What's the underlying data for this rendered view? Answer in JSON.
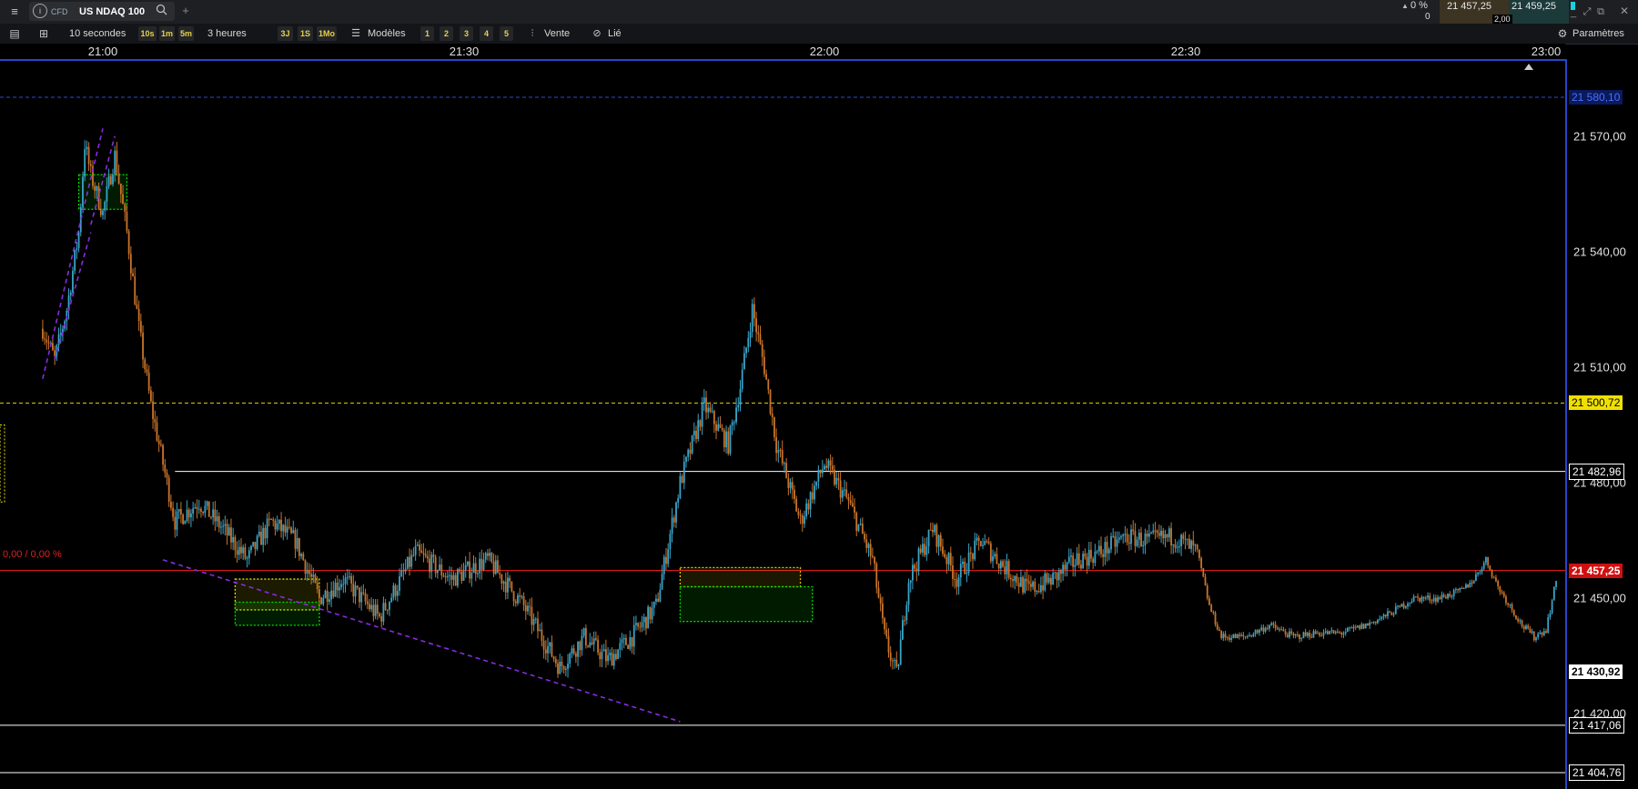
{
  "header": {
    "menu_icon": "hamburger-icon",
    "instrument_icon": "info-circle-icon",
    "instrument_type": "CFD",
    "instrument_name": "US NDAQ 100",
    "search_icon": "search-icon",
    "add_tab_icon": "plus-icon",
    "change_pct": "0 %",
    "change_qty": "0",
    "sell_price": "21 457,25",
    "buy_price": "21 459,25",
    "spread": "2,00"
  },
  "toolbar": {
    "interval": "10 secondes",
    "interval_presets": [
      "10s",
      "1m",
      "5m"
    ],
    "period": "3 heures",
    "period_presets": [
      "3J",
      "1S",
      "1Mo"
    ],
    "templates_label": "Modèles",
    "numbered_presets": [
      "1",
      "2",
      "3",
      "4",
      "5"
    ],
    "sell_label": "Vente",
    "linked_label": "Lié",
    "settings_label": "Paramètres"
  },
  "chart_data": {
    "type": "candlestick",
    "instrument": "US NDAQ 100",
    "x_ticks": [
      "21:00",
      "21:30",
      "22:00",
      "22:30",
      "23:00"
    ],
    "x_range": [
      "20:55",
      "23:01"
    ],
    "y_ticks": [
      "21 570,00",
      "21 540,00",
      "21 510,00",
      "21 480,00",
      "21 450,00",
      "21 420,00"
    ],
    "y_tick_values": [
      21570,
      21540,
      21510,
      21480,
      21450,
      21420
    ],
    "ylim": [
      21400.5,
      21590
    ],
    "bar_interval": "10 secondes",
    "current_price": 21457.25,
    "current_price_label": "21 457,25",
    "change_label": "0,00 / 0,00 %",
    "horizontal_lines": [
      {
        "value": 21580.1,
        "label": "21 580,10",
        "color": "#2a4dd8",
        "style": "dashed"
      },
      {
        "value": 21500.72,
        "label": "21 500,72",
        "color": "#e8d000",
        "style": "dashed"
      },
      {
        "value": 21482.96,
        "label": "21 482,96",
        "color": "#ffffff",
        "style": "solid",
        "from": "21:06"
      },
      {
        "value": 21457.25,
        "label": "21 457,25",
        "color": "#e01818",
        "style": "solid"
      },
      {
        "value": 21417.06,
        "label": "21 417,06",
        "color": "#ffffff",
        "style": "solid"
      },
      {
        "value": 21404.76,
        "label": "21 404,76",
        "color": "#ffffff",
        "style": "solid"
      }
    ],
    "extra_price_label": "21 430,92",
    "trendlines": [
      {
        "from": [
          "20:55",
          21507
        ],
        "to": [
          "21:00",
          21572
        ],
        "color": "#8a2be2"
      },
      {
        "from": [
          "20:56",
          21512
        ],
        "to": [
          "20:59",
          21545
        ],
        "color": "#8a2be2"
      },
      {
        "from": [
          "20:59",
          21547
        ],
        "to": [
          "21:01",
          21570
        ],
        "color": "#8a2be2"
      },
      {
        "from": [
          "21:05",
          21460
        ],
        "to": [
          "21:48",
          21418
        ],
        "color": "#8a2be2"
      }
    ],
    "zones": [
      {
        "t1": "20:58",
        "t2": "21:02",
        "p1": 21560,
        "p2": 21551,
        "color": "#00e000"
      },
      {
        "t1": "21:11",
        "t2": "21:18",
        "p1": 21455,
        "p2": 21447,
        "color": "#e8e000"
      },
      {
        "t1": "21:11",
        "t2": "21:18",
        "p1": 21449,
        "p2": 21443,
        "color": "#00e000"
      },
      {
        "t1": "21:48",
        "t2": "21:58",
        "p1": 21458,
        "p2": 21453,
        "color": "#e8c000"
      },
      {
        "t1": "21:48",
        "t2": "21:59",
        "p1": 21453,
        "p2": 21444,
        "color": "#00e000"
      }
    ],
    "price_path": [
      [
        "20:55",
        21520
      ],
      [
        "20:56",
        21512
      ],
      [
        "20:57",
        21525
      ],
      [
        "20:58",
        21545
      ],
      [
        "20:58:30",
        21568
      ],
      [
        "20:59",
        21560
      ],
      [
        "21:00",
        21550
      ],
      [
        "21:01",
        21565
      ],
      [
        "21:02",
        21545
      ],
      [
        "21:03",
        21520
      ],
      [
        "21:04",
        21500
      ],
      [
        "21:05",
        21485
      ],
      [
        "21:06",
        21470
      ],
      [
        "21:08",
        21475
      ],
      [
        "21:10",
        21468
      ],
      [
        "21:12",
        21460
      ],
      [
        "21:14",
        21470
      ],
      [
        "21:16",
        21465
      ],
      [
        "21:18",
        21450
      ],
      [
        "21:20",
        21455
      ],
      [
        "21:23",
        21445
      ],
      [
        "21:26",
        21462
      ],
      [
        "21:29",
        21455
      ],
      [
        "21:32",
        21460
      ],
      [
        "21:35",
        21448
      ],
      [
        "21:38",
        21432
      ],
      [
        "21:40",
        21440
      ],
      [
        "21:42",
        21434
      ],
      [
        "21:44",
        21440
      ],
      [
        "21:46",
        21448
      ],
      [
        "21:48",
        21480
      ],
      [
        "21:50",
        21500
      ],
      [
        "21:52",
        21490
      ],
      [
        "21:53",
        21505
      ],
      [
        "21:54",
        21525
      ],
      [
        "21:55",
        21510
      ],
      [
        "21:56",
        21490
      ],
      [
        "21:58",
        21470
      ],
      [
        "22:00",
        21485
      ],
      [
        "22:02",
        21475
      ],
      [
        "22:04",
        21460
      ],
      [
        "22:05",
        21440
      ],
      [
        "22:06",
        21430
      ],
      [
        "22:07",
        21455
      ],
      [
        "22:09",
        21468
      ],
      [
        "22:11",
        21455
      ],
      [
        "22:13",
        21465
      ],
      [
        "22:15",
        21458
      ],
      [
        "22:17",
        21452
      ],
      [
        "22:19",
        21455
      ],
      [
        "22:21",
        21460
      ],
      [
        "22:23",
        21462
      ],
      [
        "22:25",
        21466
      ],
      [
        "22:27",
        21465
      ],
      [
        "22:29",
        21466
      ],
      [
        "22:31",
        21462
      ],
      [
        "22:32",
        21448
      ],
      [
        "22:33",
        21440
      ],
      [
        "22:35",
        21440
      ],
      [
        "22:37",
        21443
      ],
      [
        "22:39",
        21440
      ],
      [
        "22:41",
        21441
      ],
      [
        "22:43",
        21441
      ],
      [
        "22:45",
        21443
      ],
      [
        "22:47",
        21446
      ],
      [
        "22:49",
        21450
      ],
      [
        "22:51",
        21450
      ],
      [
        "22:53",
        21452
      ],
      [
        "22:54",
        21455
      ],
      [
        "22:55",
        21460
      ],
      [
        "22:56",
        21453
      ],
      [
        "22:57",
        21448
      ],
      [
        "22:58",
        21443
      ],
      [
        "22:59",
        21440
      ],
      [
        "23:00",
        21442
      ],
      [
        "23:01",
        21457
      ]
    ],
    "up_color": "#3aa4c8",
    "down_color": "#c8742a"
  }
}
